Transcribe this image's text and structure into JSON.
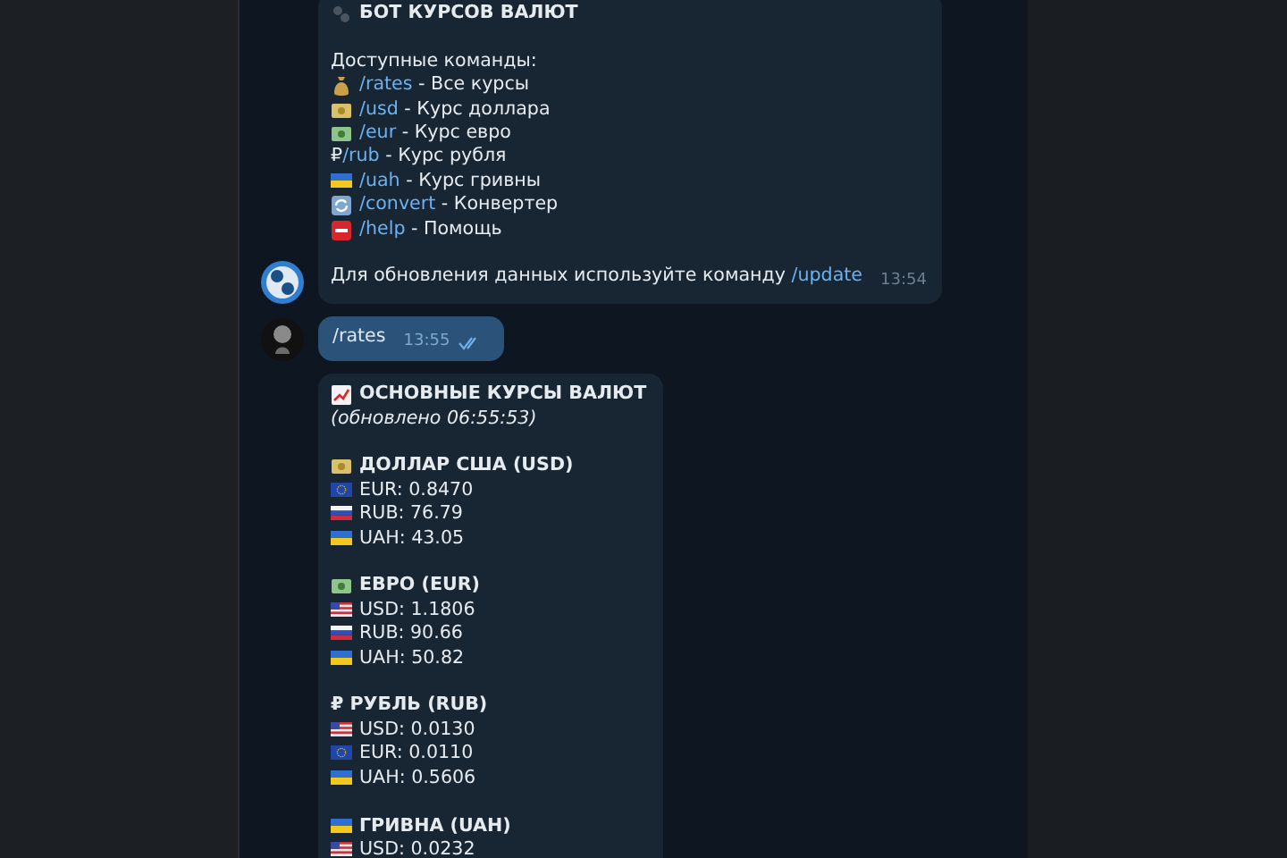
{
  "messages": [
    {
      "kind": "bot_help",
      "title": "БОТ КУРСОВ ВАЛЮТ",
      "intro": "Доступные команды:",
      "commands": [
        {
          "command": "/rates",
          "description": " - Все курсы"
        },
        {
          "command": "/usd",
          "description": " - Курс доллара"
        },
        {
          "command": "/eur",
          "description": " - Курс евро"
        },
        {
          "symbol": "₽",
          "command": "/rub",
          "description": " - Курс рубля"
        },
        {
          "command": "/uah",
          "description": " - Курс гривны"
        },
        {
          "command": "/convert",
          "description": " - Конвертер"
        },
        {
          "command": "/help",
          "description": " - Помощь"
        }
      ],
      "footer": "Для обновления данных используйте команду ",
      "footer_command": "/update",
      "time": "13:54",
      "avatar": true
    },
    {
      "kind": "outgoing",
      "text": "/rates",
      "time": "13:55",
      "read": true,
      "avatar": true
    },
    {
      "kind": "bot_rates",
      "title": "ОСНОВНЫЕ КУРСЫ ВАЛЮТ",
      "subtitle": "(обновлено 06:55:53)",
      "sections": [
        {
          "heading": "ДОЛЛАР США (USD)",
          "rows": [
            "EUR: 0.8470",
            "RUB: 76.79",
            "UAH: 43.05"
          ]
        },
        {
          "heading": "ЕВРО (EUR)",
          "rows": [
            "USD: 1.1806",
            "RUB: 90.66",
            "UAH: 50.82"
          ]
        },
        {
          "heading": "₽ РУБЛЬ (RUB)",
          "rows": [
            "USD: 0.0130",
            "EUR: 0.0110",
            "UAH: 0.5606"
          ]
        },
        {
          "heading": "ГРИВНА (UAH)",
          "rows": [
            "USD: 0.0232"
          ]
        }
      ],
      "avatar": false
    }
  ]
}
